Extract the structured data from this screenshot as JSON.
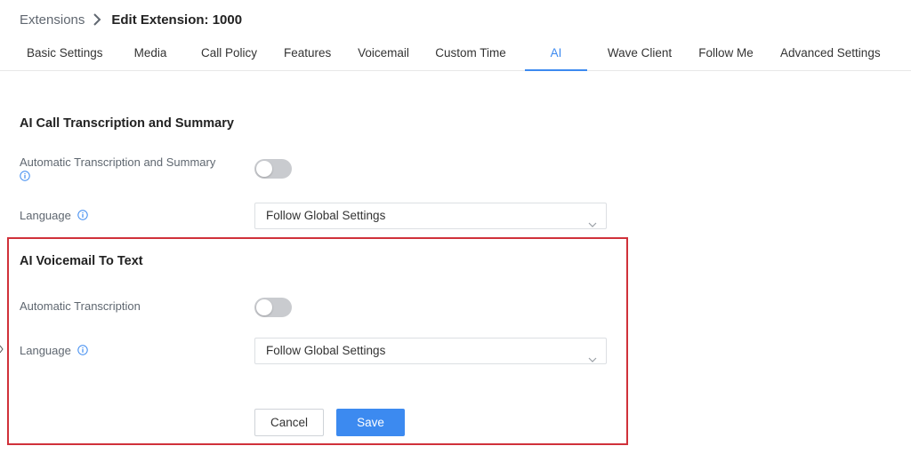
{
  "breadcrumb": {
    "parent": "Extensions",
    "separator_icon": "chevron-right-icon",
    "current": "Edit Extension: 1000"
  },
  "tabs": [
    {
      "label": "Basic Settings",
      "active": false
    },
    {
      "label": "Media",
      "active": false
    },
    {
      "label": "Call Policy",
      "active": false
    },
    {
      "label": "Features",
      "active": false
    },
    {
      "label": "Voicemail",
      "active": false
    },
    {
      "label": "Custom Time",
      "active": false
    },
    {
      "label": "AI",
      "active": true
    },
    {
      "label": "Wave Client",
      "active": false
    },
    {
      "label": "Follow Me",
      "active": false
    },
    {
      "label": "Advanced Settings",
      "active": false
    }
  ],
  "transcription": {
    "title": "AI Call Transcription and Summary",
    "auto_label": "Automatic Transcription and Summary",
    "auto_enabled": false,
    "language_label": "Language",
    "language_value": "Follow Global Settings"
  },
  "voicemail": {
    "title": "AI Voicemail To Text",
    "auto_label": "Automatic Transcription",
    "auto_enabled": false,
    "language_label": "Language",
    "language_value": "Follow Global Settings"
  },
  "actions": {
    "cancel_label": "Cancel",
    "save_label": "Save"
  },
  "colors": {
    "accent": "#3c8af0",
    "highlight": "#d0313a",
    "toggle_off": "#c9cbcf"
  }
}
